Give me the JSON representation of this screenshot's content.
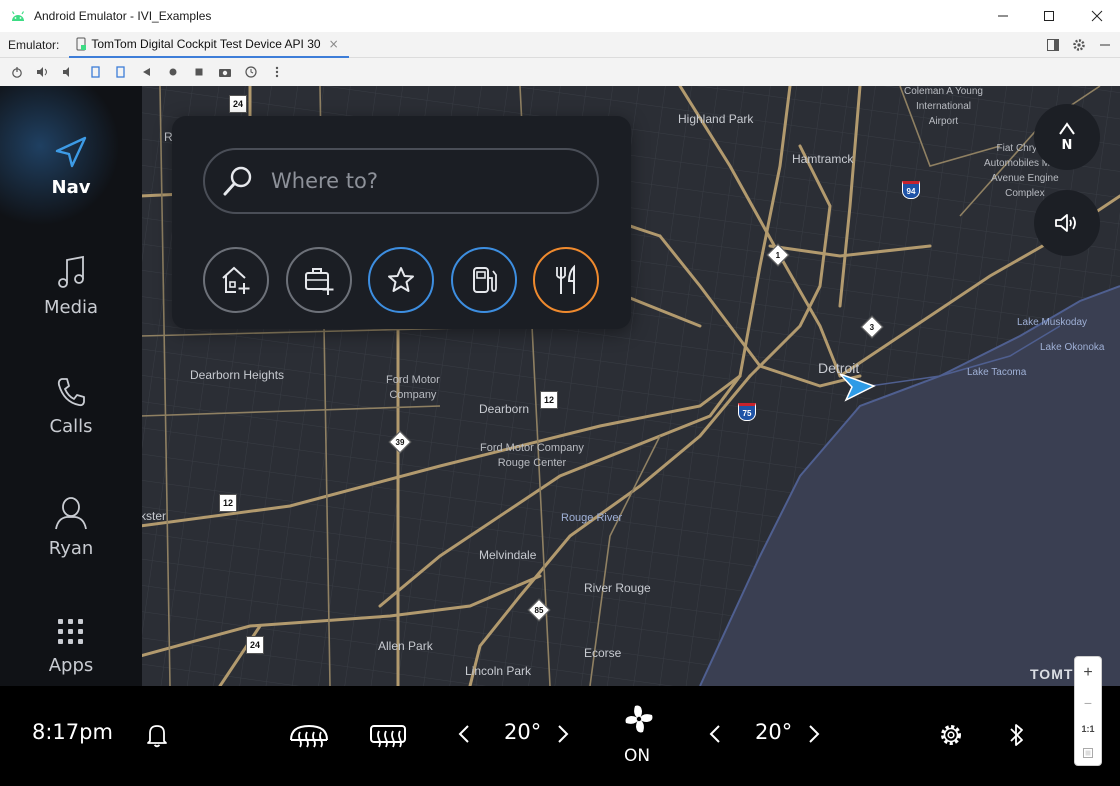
{
  "window": {
    "title": "Android Emulator - IVI_Examples",
    "emulator_label": "Emulator:",
    "tab_label": "TomTom Digital Cockpit Test Device API 30",
    "tab_close": "×"
  },
  "rail": {
    "items": [
      {
        "label": "Nav",
        "icon": "navigation-arrow-icon",
        "active": true
      },
      {
        "label": "Media",
        "icon": "music-note-icon"
      },
      {
        "label": "Calls",
        "icon": "phone-icon"
      },
      {
        "label": "Ryan",
        "icon": "user-profile-icon"
      },
      {
        "label": "Apps",
        "icon": "apps-grid-icon"
      }
    ]
  },
  "search": {
    "placeholder": "Where to?",
    "quick_actions": [
      "add-home-icon",
      "add-work-icon",
      "favorites-star-icon",
      "fuel-station-icon",
      "restaurant-icon"
    ]
  },
  "map": {
    "labels": {
      "highland_park": "Highland Park",
      "hamtramck": "Hamtramck",
      "detroit": "Detroit",
      "dearborn_heights": "Dearborn Heights",
      "ford_motor_company": "Ford Motor\nCompany",
      "dearborn": "Dearborn",
      "ford_rouge": "Ford Motor Company\nRouge Center",
      "rouge_river": "Rouge River",
      "melvindale": "Melvindale",
      "river_rouge": "River Rouge",
      "allen_park": "Allen Park",
      "ecorse": "Ecorse",
      "lincoln_park": "Lincoln Park",
      "airport": "Coleman A Young\nInternational\nAirport",
      "fiat": "Fiat Chrysler\nAutomobiles Mack\nAvenue Engine\nComplex",
      "lake_muskoday": "Lake Muskoday",
      "lake_okonoka": "Lake Okonoka",
      "lake_tacoma": "Lake Tacoma",
      "re": "Re",
      "kster": "kster"
    },
    "shields": {
      "s24a": "24",
      "s24b": "24",
      "s94": "94",
      "s1": "1",
      "s3": "3",
      "s12a": "12",
      "s12b": "12",
      "s75": "75",
      "s39": "39",
      "s85": "85"
    },
    "watermark": "TOMT",
    "compass": "N",
    "zoom": {
      "plus": "+",
      "minus": "−",
      "one_to_one": "1:1"
    }
  },
  "bottom_bar": {
    "time": "8:17pm",
    "left_temp": "20°",
    "right_temp": "20°",
    "fan_status": "ON"
  }
}
